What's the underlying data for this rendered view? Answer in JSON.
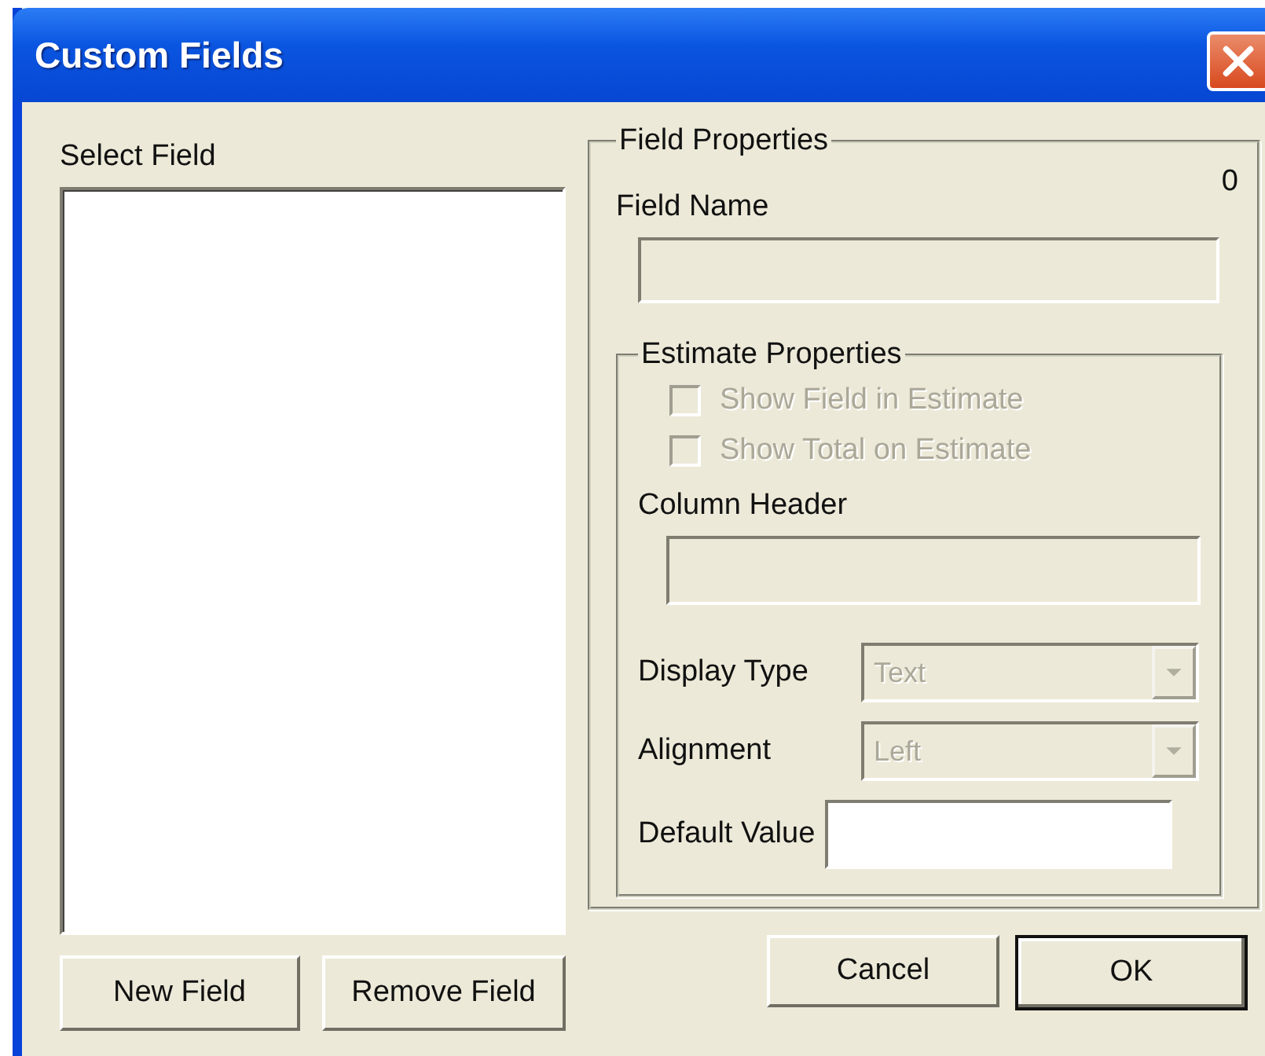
{
  "window": {
    "title": "Custom Fields"
  },
  "select_field": {
    "label": "Select Field"
  },
  "left_buttons": [
    "New Field",
    "Remove Field"
  ],
  "field_properties": {
    "title": "Field Properties",
    "count": "0",
    "field_name": {
      "label": "Field Name",
      "disabled": true
    },
    "estimate_properties": {
      "title": "Estimate Properties",
      "checkboxes": [
        {
          "label": "Show Field in Estimate",
          "checked": false,
          "disabled": true
        },
        {
          "label": "Show Total on Estimate",
          "checked": false,
          "disabled": true
        }
      ],
      "column_header": {
        "label": "Column Header",
        "disabled": true
      },
      "display_type": {
        "label": "Display Type",
        "value": "Text",
        "disabled": true
      },
      "alignment": {
        "label": "Alignment",
        "value": "Left",
        "disabled": true
      },
      "default_value": {
        "label": "Default Value",
        "disabled": false
      }
    }
  },
  "buttons": [
    {
      "label": "Cancel",
      "default": false
    },
    {
      "label": "OK",
      "default": true
    }
  ]
}
